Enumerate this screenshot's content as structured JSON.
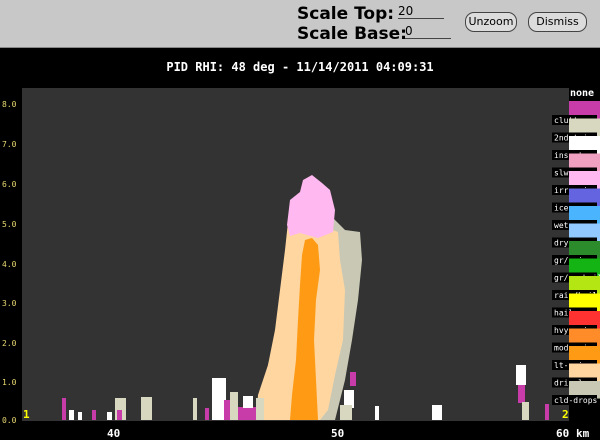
{
  "controls": {
    "scale_top_label": "Scale Top:",
    "scale_top_value": "20",
    "scale_base_label": "Scale Base:",
    "scale_base_value": "0",
    "unzoom_label": "Unzoom",
    "dismiss_label": "Dismiss"
  },
  "plot_title": "PID  RHI: 48 deg  -  11/14/2011 04:09:31",
  "colors": {
    "background": "#000000",
    "plot_area": "#333333",
    "control_bar": "#c8c8c8",
    "y_tick_text": "#e8d870",
    "x_tick_text": "#ffffff"
  },
  "legend": {
    "header": "none",
    "items": [
      {
        "label": "clutter",
        "color": "#c83caa"
      },
      {
        "label": "2nd-trip",
        "color": "#d8d8c0"
      },
      {
        "label": "insects",
        "color": "#ffffff"
      },
      {
        "label": "slw",
        "color": "#f0a0c0"
      },
      {
        "label": "irreg-ice",
        "color": "#ffb8f0"
      },
      {
        "label": "ice",
        "color": "#6464e0"
      },
      {
        "label": "wet-snow",
        "color": "#4ab4ff"
      },
      {
        "label": "dry-snow",
        "color": "#90c8ff"
      },
      {
        "label": "gr/rain",
        "color": "#2c8c2c"
      },
      {
        "label": "gr/sm-hail",
        "color": "#14b414"
      },
      {
        "label": "rain/hail",
        "color": "#b4e614"
      },
      {
        "label": "hail",
        "color": "#ffff00"
      },
      {
        "label": "hvy-rain",
        "color": "#ff3232"
      },
      {
        "label": "mod-rain",
        "color": "#ff8c28"
      },
      {
        "label": "lt-rain",
        "color": "#ff9a14"
      },
      {
        "label": "drizzle",
        "color": "#ffd6a0"
      },
      {
        "label": "cld-drops",
        "color": "#c8c8b4"
      }
    ]
  },
  "axes": {
    "y_ticks": [
      "0.0",
      "1.0",
      "2.0",
      "3.0",
      "4.0",
      "5.0",
      "6.0",
      "7.0",
      "8.0"
    ],
    "x_ticks": [
      "40",
      "50",
      "60"
    ],
    "x_unit": "km",
    "corner_left": "1",
    "corner_right": "2"
  }
}
